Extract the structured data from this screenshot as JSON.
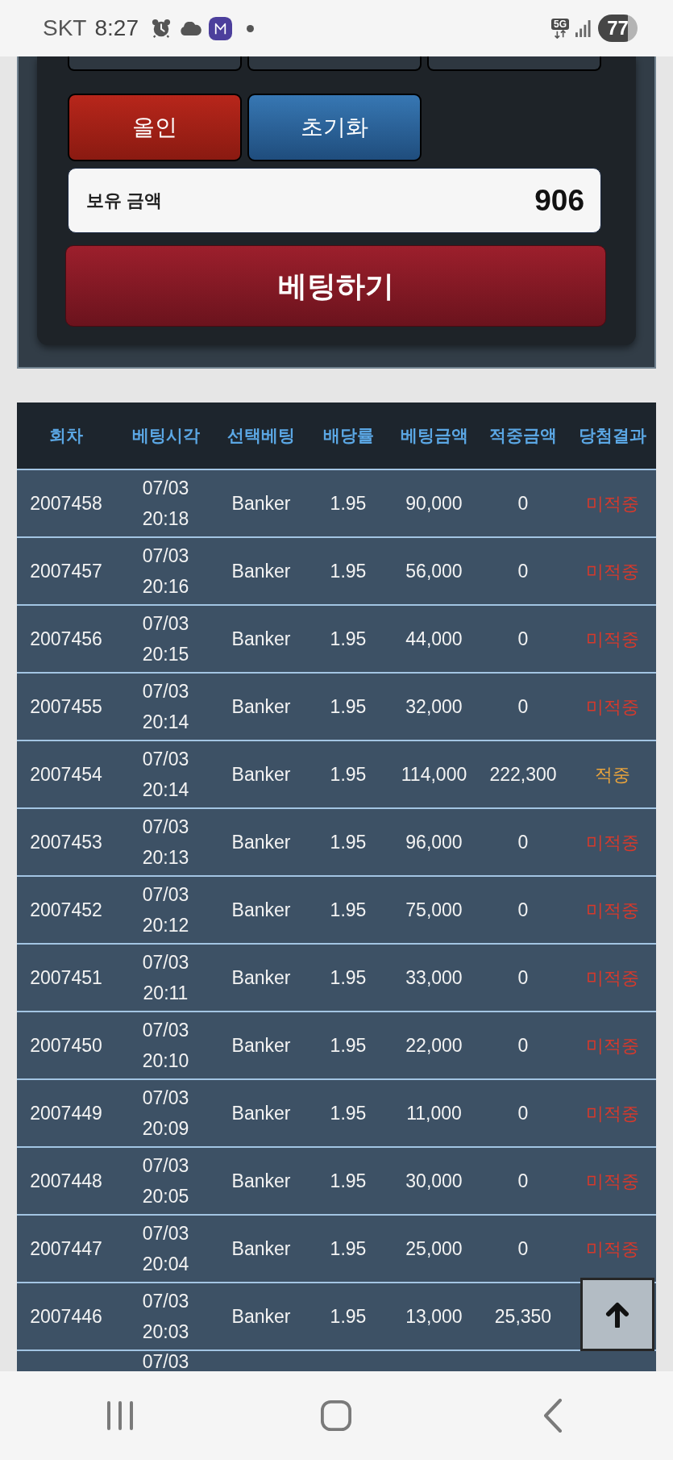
{
  "status_bar": {
    "carrier": "SKT",
    "time": "8:27",
    "network_type": "5G",
    "battery": "77"
  },
  "bet_panel": {
    "actions": [
      {
        "label": "올인",
        "kind": "all_in"
      },
      {
        "label": "초기화",
        "kind": "reset"
      }
    ],
    "balance": {
      "label": "보유 금액",
      "value": "906"
    },
    "submit": {
      "label": "베팅하기"
    }
  },
  "table": {
    "columns": [
      "회차",
      "베팅시각",
      "선택베팅",
      "배당률",
      "베팅금액",
      "적중금액",
      "당첨결과"
    ],
    "rows": [
      {
        "round": "2007458",
        "time": "07/03 20:18",
        "pick": "Banker",
        "odds": "1.95",
        "bet": "90,000",
        "win": "0",
        "result": "미적중",
        "color": "#d8392b"
      },
      {
        "round": "2007457",
        "time": "07/03 20:16",
        "pick": "Banker",
        "odds": "1.95",
        "bet": "56,000",
        "win": "0",
        "result": "미적중",
        "color": "#d8392b"
      },
      {
        "round": "2007456",
        "time": "07/03 20:15",
        "pick": "Banker",
        "odds": "1.95",
        "bet": "44,000",
        "win": "0",
        "result": "미적중",
        "color": "#d8392b"
      },
      {
        "round": "2007455",
        "time": "07/03 20:14",
        "pick": "Banker",
        "odds": "1.95",
        "bet": "32,000",
        "win": "0",
        "result": "미적중",
        "color": "#d8392b"
      },
      {
        "round": "2007454",
        "time": "07/03 20:14",
        "pick": "Banker",
        "odds": "1.95",
        "bet": "114,000",
        "win": "222,300",
        "result": "적중",
        "color": "#eaa43c"
      },
      {
        "round": "2007453",
        "time": "07/03 20:13",
        "pick": "Banker",
        "odds": "1.95",
        "bet": "96,000",
        "win": "0",
        "result": "미적중",
        "color": "#d8392b"
      },
      {
        "round": "2007452",
        "time": "07/03 20:12",
        "pick": "Banker",
        "odds": "1.95",
        "bet": "75,000",
        "win": "0",
        "result": "미적중",
        "color": "#d8392b"
      },
      {
        "round": "2007451",
        "time": "07/03 20:11",
        "pick": "Banker",
        "odds": "1.95",
        "bet": "33,000",
        "win": "0",
        "result": "미적중",
        "color": "#d8392b"
      },
      {
        "round": "2007450",
        "time": "07/03 20:10",
        "pick": "Banker",
        "odds": "1.95",
        "bet": "22,000",
        "win": "0",
        "result": "미적중",
        "color": "#d8392b"
      },
      {
        "round": "2007449",
        "time": "07/03 20:09",
        "pick": "Banker",
        "odds": "1.95",
        "bet": "11,000",
        "win": "0",
        "result": "미적중",
        "color": "#d8392b"
      },
      {
        "round": "2007448",
        "time": "07/03 20:05",
        "pick": "Banker",
        "odds": "1.95",
        "bet": "30,000",
        "win": "0",
        "result": "미적중",
        "color": "#d8392b"
      },
      {
        "round": "2007447",
        "time": "07/03 20:04",
        "pick": "Banker",
        "odds": "1.95",
        "bet": "25,000",
        "win": "0",
        "result": "미적중",
        "color": "#d8392b"
      },
      {
        "round": "2007446",
        "time": "07/03 20:03",
        "pick": "Banker",
        "odds": "1.95",
        "bet": "13,000",
        "win": "25,350"
      }
    ],
    "partial_row": {
      "time": "07/03"
    }
  }
}
